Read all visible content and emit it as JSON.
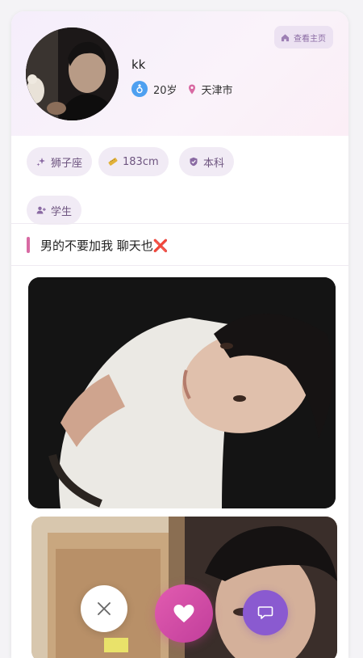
{
  "header": {
    "homepage_button_label": "查看主页",
    "nickname": "kk",
    "age": "20岁",
    "city": "天津市"
  },
  "tags": [
    {
      "icon": "sparkle-icon",
      "label": "狮子座"
    },
    {
      "icon": "ruler-icon",
      "label": "183cm"
    },
    {
      "icon": "shield-check-icon",
      "label": "本科"
    },
    {
      "icon": "user-plus-icon",
      "label": "学生"
    }
  ],
  "bio": {
    "text": "男的不要加我 聊天也❌"
  },
  "actions": {
    "dislike_icon": "close-icon",
    "like_icon": "heart-icon",
    "chat_icon": "chat-bubble-icon"
  },
  "colors": {
    "accent_pink": "#d86aa3",
    "accent_purple": "#8a5ad0",
    "tag_bg": "#f1ebf5",
    "gender_blue": "#4ea0f0"
  }
}
